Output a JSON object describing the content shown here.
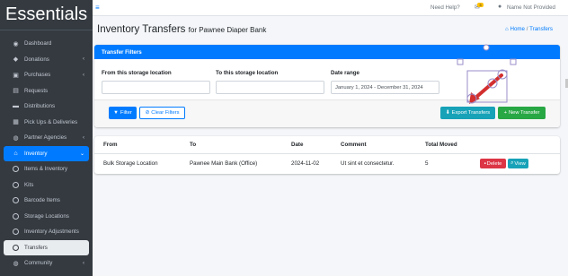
{
  "brand": "Essentials",
  "sidebar": {
    "items": [
      {
        "label": "Dashboard",
        "icon": "dashboard-icon",
        "glyph": "◉"
      },
      {
        "label": "Donations",
        "icon": "donations-icon",
        "glyph": "◆",
        "chevron": "‹"
      },
      {
        "label": "Purchases",
        "icon": "cart-icon",
        "glyph": "▣",
        "chevron": "‹"
      },
      {
        "label": "Requests",
        "icon": "document-icon",
        "glyph": "▤"
      },
      {
        "label": "Distributions",
        "icon": "truck-icon",
        "glyph": "▬"
      },
      {
        "label": "Pick Ups & Deliveries",
        "icon": "calendar-icon",
        "glyph": "▦"
      },
      {
        "label": "Partner Agencies",
        "icon": "users-icon",
        "glyph": "◍",
        "chevron": "‹"
      },
      {
        "label": "Inventory",
        "icon": "home-icon",
        "glyph": "⌂",
        "chevron": "⌄"
      },
      {
        "label": "Items & Inventory",
        "icon": "circle-icon"
      },
      {
        "label": "Kits",
        "icon": "circle-icon"
      },
      {
        "label": "Barcode Items",
        "icon": "circle-icon"
      },
      {
        "label": "Storage Locations",
        "icon": "circle-icon"
      },
      {
        "label": "Inventory Adjustments",
        "icon": "circle-icon"
      },
      {
        "label": "Transfers",
        "icon": "circle-icon"
      },
      {
        "label": "Community",
        "icon": "community-icon",
        "glyph": "◍",
        "chevron": "‹"
      }
    ]
  },
  "topbar": {
    "menu_glyph": "≡",
    "help": "Need Help?",
    "user": "Name Not Provided",
    "badge": "3"
  },
  "header": {
    "title": "Inventory Transfers",
    "subtitle": "for Pawnee Diaper Bank",
    "breadcrumb_home": "Home",
    "breadcrumb_sep": "/",
    "breadcrumb_current": "Transfers"
  },
  "filters": {
    "card_title": "Transfer Filters",
    "from_label": "From this storage location",
    "to_label": "To this storage location",
    "date_label": "Date range",
    "from_value": "",
    "to_value": "",
    "date_value": "January 1, 2024 - December 31, 2024",
    "filter_button": "Filter",
    "clear_button": "Clear Filters",
    "export_button": "Export Transfers",
    "new_button": "New Transfer"
  },
  "table": {
    "headers": [
      "From",
      "To",
      "Date",
      "Comment",
      "Total Moved"
    ],
    "rows": [
      {
        "from": "Bulk Storage Location",
        "to": "Pawnee Main Bank (Office)",
        "date": "2024-11-02",
        "comment": "Ut sint et consectetur.",
        "total": "5",
        "delete": "Delete",
        "view": "View"
      }
    ]
  },
  "colors": {
    "primary": "#007bff",
    "sidebar": "#343a40",
    "success": "#28a745",
    "info": "#17a2b8",
    "danger": "#dc3545",
    "annotation": "#d32f2f"
  }
}
